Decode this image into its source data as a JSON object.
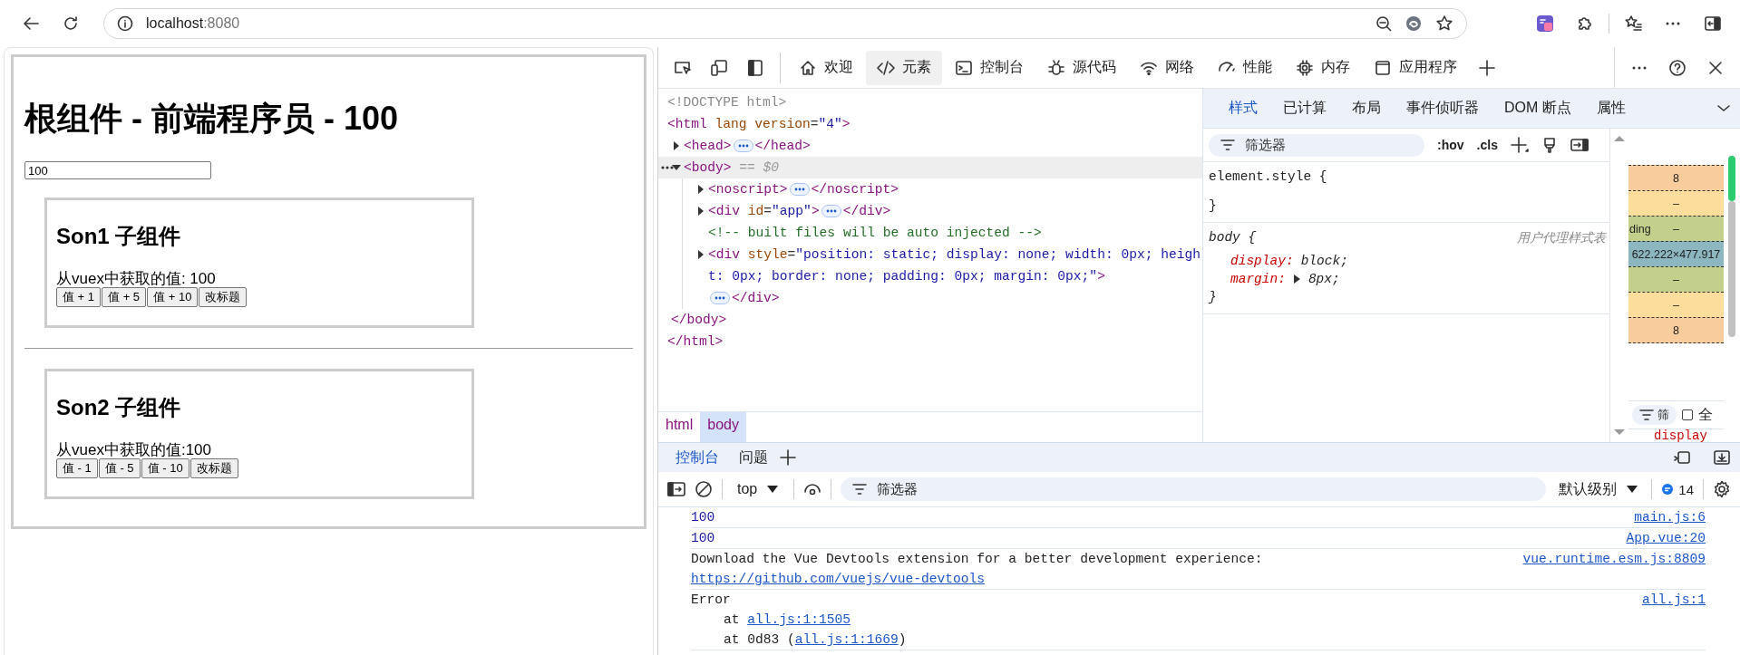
{
  "browser": {
    "url": {
      "host": "localhost",
      "port": ":8080"
    }
  },
  "page": {
    "title": "根组件 - 前端程序员 - 100",
    "input_value": "100",
    "sections": [
      {
        "heading": "Son1 子组件",
        "text": "从vuex中获取的值: 100",
        "buttons": [
          "值 + 1",
          "值 + 5",
          "值 + 10",
          "改标题"
        ]
      },
      {
        "heading": "Son2 子组件",
        "text": "从vuex中获取的值:100",
        "buttons": [
          "值 - 1",
          "值 - 5",
          "值 - 10",
          "改标题"
        ]
      }
    ]
  },
  "devtools": {
    "tabs": [
      {
        "label": "欢迎",
        "selected": false
      },
      {
        "label": "元素",
        "selected": true
      },
      {
        "label": "控制台",
        "selected": false
      },
      {
        "label": "源代码",
        "selected": false
      },
      {
        "label": "网络",
        "selected": false
      },
      {
        "label": "性能",
        "selected": false
      },
      {
        "label": "内存",
        "selected": false
      },
      {
        "label": "应用程序",
        "selected": false
      }
    ],
    "elements": {
      "nodes": [
        {
          "kind": "doctype",
          "text": "<!DOCTYPE html>",
          "selected": false
        },
        {
          "kind": "element",
          "text": "<html lang version=\"4\">",
          "close": "</html>",
          "selected": false,
          "children": [
            {
              "kind": "element",
              "text": "<head>",
              "close": "</head>",
              "expanded": false,
              "selected": false
            },
            {
              "kind": "element",
              "text": "<body>",
              "close": "</body>",
              "expanded": true,
              "selected": true,
              "suffix": "== $0",
              "children": [
                {
                  "kind": "element",
                  "text": "<noscript>",
                  "close": "</noscript>",
                  "expanded": false,
                  "selected": false
                },
                {
                  "kind": "element",
                  "text": "<div id=\"app\">",
                  "close": "</div>",
                  "expanded": false,
                  "selected": false
                },
                {
                  "kind": "comment",
                  "text": "<!-- built files will be auto injected -->",
                  "selected": false
                },
                {
                  "kind": "element",
                  "text": "<div style=\"position: static; display: none; width: 0px; height: 0px; border: none; padding: 0px; margin: 0px;\">",
                  "close": "</div>",
                  "expanded": false,
                  "selected": false
                }
              ]
            }
          ]
        }
      ],
      "breadcrumbs": [
        {
          "label": "html",
          "selected": false
        },
        {
          "label": "body",
          "selected": true
        }
      ]
    },
    "styles": {
      "tabs": [
        {
          "label": "样式",
          "selected": true
        },
        {
          "label": "已计算",
          "selected": false
        },
        {
          "label": "布局",
          "selected": false
        },
        {
          "label": "事件侦听器",
          "selected": false
        },
        {
          "label": "DOM 断点",
          "selected": false
        },
        {
          "label": "属性",
          "selected": false
        }
      ],
      "filter_placeholder": "筛选器",
      "toggles": [
        ":hov",
        ".cls"
      ],
      "rules": [
        {
          "selector": "element.style {",
          "close": "}"
        },
        {
          "selector": "body {",
          "source": "用户代理样式表",
          "close": "}",
          "properties": [
            {
              "name": "display:",
              "value": "block;",
              "expandable": false
            },
            {
              "name": "margin:",
              "value": "8px;",
              "expandable": true
            }
          ]
        }
      ],
      "box_model": {
        "layers": [
          {
            "value": "8",
            "color": "#f9cc9d"
          },
          {
            "value": "–",
            "color": "#fddd9b"
          },
          {
            "label": "ding",
            "value": "–",
            "color": "#c3d08b"
          },
          {
            "value": "622.222×477.917",
            "color": "#8cb6c0"
          },
          {
            "value": "–",
            "color": "#c3d08b"
          },
          {
            "value": "–",
            "color": "#fddd9b"
          },
          {
            "value": "8",
            "color": "#f9cc9d"
          }
        ],
        "filter_label": "筛",
        "checkbox_label": "全",
        "checked": false,
        "property": "display"
      }
    },
    "console": {
      "tabs": [
        {
          "label": "控制台",
          "selected": true
        },
        {
          "label": "问题",
          "selected": false
        }
      ],
      "context": "top",
      "filter_placeholder": "筛选器",
      "level": "默认级别",
      "message_count": "14",
      "messages": [
        {
          "kind": "number",
          "text": "100",
          "source": "main.js:6"
        },
        {
          "kind": "number",
          "text": "100",
          "source": "App.vue:20"
        },
        {
          "kind": "text",
          "text": "Download the Vue Devtools extension for a better development experience:",
          "link": "https://github.com/vuejs/vue-devtools",
          "source": "vue.runtime.esm.js:8809"
        },
        {
          "kind": "error",
          "text": "Error",
          "source": "all.js:1",
          "stack": [
            {
              "text": "at ",
              "link": "all.js:1:1505"
            },
            {
              "text": "at 0d83 (",
              "link": "all.js:1:1669",
              "after": ")"
            }
          ]
        }
      ]
    }
  }
}
